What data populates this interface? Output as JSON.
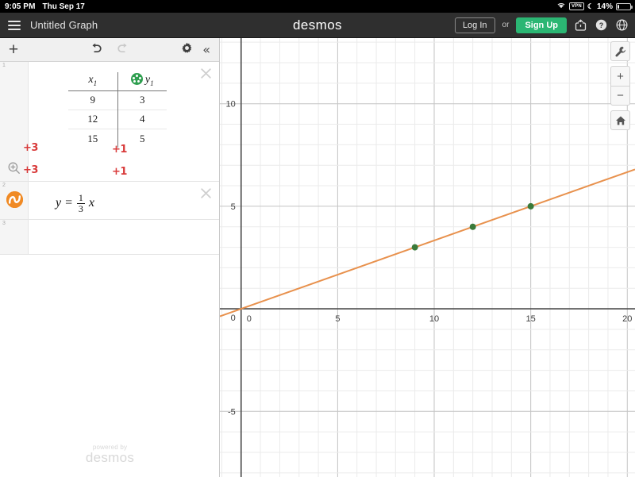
{
  "statusbar": {
    "time": "9:05 PM",
    "date": "Thu Sep 17",
    "vpn_label": "VPN",
    "battery_percent": "14%",
    "wifi_icon": "wifi-icon",
    "moon_icon": "moon-icon",
    "battery_icon": "battery-icon"
  },
  "navbar": {
    "menu_icon": "hamburger-menu-icon",
    "title": "Untitled Graph",
    "brand": "desmos",
    "login_label": "Log In",
    "or_label": "or",
    "signup_label": "Sign Up",
    "share_icon": "share-icon",
    "help_icon": "help-icon",
    "language_icon": "globe-icon",
    "signup_color": "#2bb673",
    "background_color": "#2f2f2f"
  },
  "toolbar": {
    "add_label": "+",
    "undo_icon": "undo-arrow-icon",
    "redo_icon": "redo-arrow-icon",
    "settings_icon": "gear-icon",
    "collapse_label": "«"
  },
  "expressions": {
    "row1": {
      "number": "1",
      "type": "table",
      "columns": [
        {
          "name": "x",
          "subscript": "1"
        },
        {
          "name": "y",
          "subscript": "1"
        }
      ],
      "point_style_color": "#2e9e4f",
      "rows": [
        {
          "x": "9",
          "y": "3"
        },
        {
          "x": "12",
          "y": "4"
        },
        {
          "x": "15",
          "y": "5"
        }
      ],
      "annotations": {
        "x_step_1": "+3",
        "x_step_2": "+3",
        "y_step_1": "+1",
        "y_step_2": "+1",
        "color": "#d93b3b"
      },
      "zoom_fit_icon": "zoom-fit-icon",
      "close_icon": "close-icon"
    },
    "row2": {
      "number": "2",
      "type": "equation",
      "lhs": "y",
      "equals": "=",
      "fraction_numerator": "1",
      "fraction_denominator": "3",
      "variable": "x",
      "curve_color": "#f08a24",
      "curve_icon": "curve-style-icon",
      "close_icon": "close-icon"
    },
    "row3": {
      "number": "3",
      "type": "empty"
    }
  },
  "watermark": {
    "line1": "powered by",
    "line2": "desmos"
  },
  "graph_controls": {
    "settings_icon": "wrench-icon",
    "zoom_in_label": "+",
    "zoom_out_label": "−",
    "home_icon": "home-icon"
  },
  "chart_data": {
    "type": "line",
    "title": "",
    "xlabel": "",
    "ylabel": "",
    "xlim": [
      -1.1,
      20.4
    ],
    "ylim": [
      -8.2,
      13.2
    ],
    "x_ticks": [
      0,
      5,
      10,
      15,
      20
    ],
    "y_ticks": [
      10,
      5,
      0,
      -5
    ],
    "x_tick_labels": [
      "0",
      "5",
      "10",
      "15",
      "20"
    ],
    "y_tick_labels": [
      "10",
      "5",
      "0",
      "-5"
    ],
    "grid": true,
    "minor_grid_step": 1,
    "major_grid_step": 5,
    "legend": "none",
    "series": [
      {
        "name": "y = (1/3)x",
        "type": "line",
        "color": "#e8914d",
        "slope": 0.3333333,
        "intercept": 0,
        "x": [
          -1.1,
          20.4
        ],
        "values": [
          -0.3667,
          6.8
        ]
      },
      {
        "name": "table points (x1, y1)",
        "type": "scatter",
        "color": "#3a7a3a",
        "x": [
          9,
          12,
          15
        ],
        "values": [
          3,
          4,
          5
        ]
      }
    ]
  }
}
